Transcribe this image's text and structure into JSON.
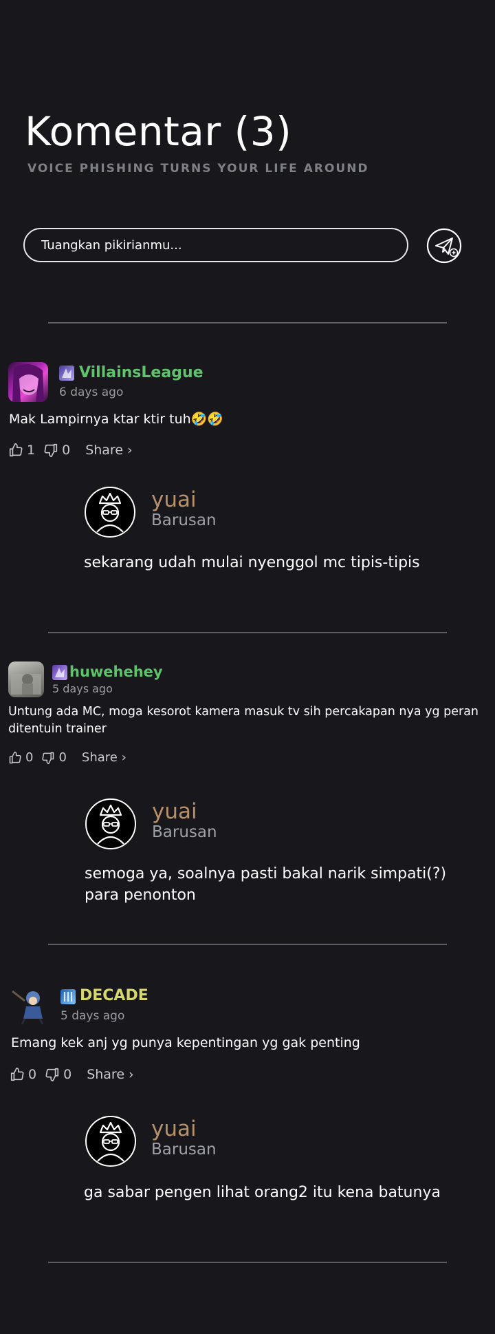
{
  "header": {
    "title": "Komentar (3)",
    "subtitle": "VOICE PHISHING TURNS YOUR LIFE AROUND"
  },
  "composer": {
    "placeholder": "Tuangkan pikirianmu...",
    "send_icon": "paper-plane-plus-icon"
  },
  "comments": [
    {
      "username": "VillainsLeague",
      "username_color": "#5fc36b",
      "time": "6 days ago",
      "text": "Mak Lampirnya ktar ktir tuh🤣🤣",
      "likes": "1",
      "dislikes": "0",
      "share": "Share ›",
      "reply": {
        "username": "yuai",
        "time": "Barusan",
        "text": "sekarang udah mulai nyenggol mc tipis-tipis"
      }
    },
    {
      "username": "huwehehey",
      "username_color": "#5fc36b",
      "time": "5 days ago",
      "text": "Untung ada MC, moga kesorot kamera masuk tv sih percakapan nya yg peran ditentuin trainer",
      "likes": "0",
      "dislikes": "0",
      "share": "Share ›",
      "reply": {
        "username": "yuai",
        "time": "Barusan",
        "text": "semoga ya, soalnya pasti bakal narik simpati(?) para penonton"
      }
    },
    {
      "username": "DECADE",
      "username_color": "#d6d96a",
      "time": "5 days ago",
      "text": "Emang kek anj yg punya kepentingan yg gak penting",
      "likes": "0",
      "dislikes": "0",
      "share": "Share ›",
      "reply": {
        "username": "yuai",
        "time": "Barusan",
        "text": "ga sabar pengen lihat orang2 itu kena batunya"
      }
    }
  ],
  "colors": {
    "background": "#17171c",
    "reply_name": "#b8906a",
    "muted": "#9b9ba4"
  }
}
